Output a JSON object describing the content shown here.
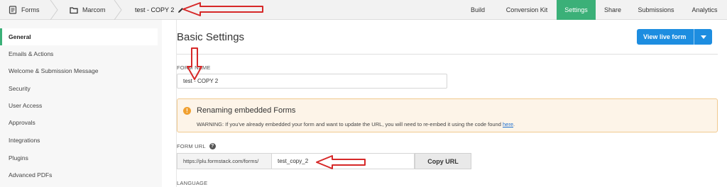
{
  "breadcrumb": {
    "forms_label": "Forms",
    "folder_label": "Marcom",
    "form_title": "test - COPY 2"
  },
  "tabs": [
    {
      "label": "Build"
    },
    {
      "label": "Conversion Kit"
    },
    {
      "label": "Settings",
      "active": true
    },
    {
      "label": "Share"
    },
    {
      "label": "Submissions"
    },
    {
      "label": "Analytics"
    }
  ],
  "sidebar": {
    "items": [
      {
        "label": "General",
        "active": true
      },
      {
        "label": "Emails & Actions"
      },
      {
        "label": "Welcome & Submission Message"
      },
      {
        "label": "Security"
      },
      {
        "label": "User Access"
      },
      {
        "label": "Approvals"
      },
      {
        "label": "Integrations"
      },
      {
        "label": "Plugins"
      },
      {
        "label": "Advanced PDFs"
      }
    ]
  },
  "main": {
    "heading": "Basic Settings",
    "view_live_label": "View live form",
    "form_name_label": "FORM NAME",
    "form_name_value": "test - COPY 2",
    "alert": {
      "title": "Renaming embedded Forms",
      "message": "WARNING: If you've already embedded your form and want to update the URL, you will need to re-embed it using the code found ",
      "link_text": "here",
      "message_end": "."
    },
    "form_url_label": "FORM URL",
    "url_prefix": "https://plu.formstack.com/forms/",
    "url_slug": "test_copy_2",
    "copy_url_label": "Copy URL",
    "language_label": "LANGUAGE"
  },
  "colors": {
    "accent": "#3bb078",
    "primary_button": "#1d8de0",
    "annotation_arrow": "#d62828",
    "alert_bg": "#fdf4e8",
    "alert_icon": "#f0a030"
  }
}
